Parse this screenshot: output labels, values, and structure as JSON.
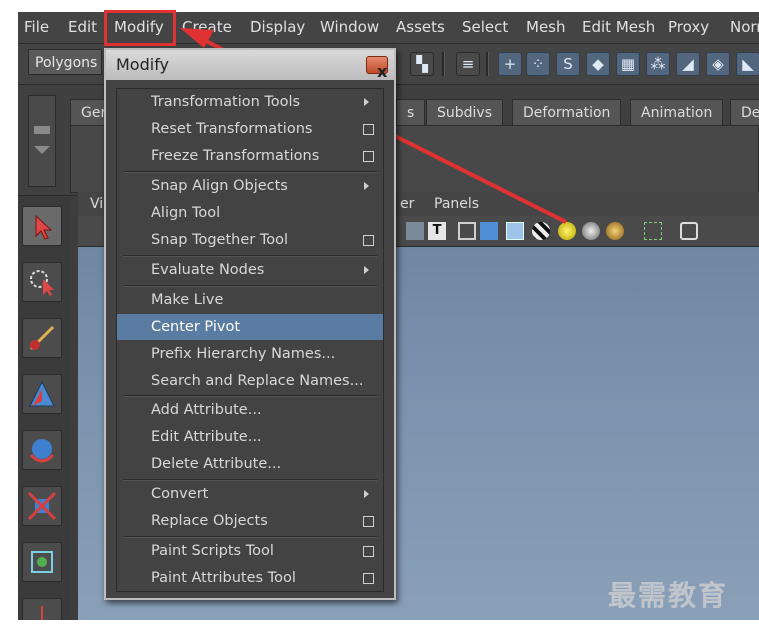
{
  "menubar": [
    "File",
    "Edit",
    "Modify",
    "Create",
    "Display",
    "Window",
    "Assets",
    "Select",
    "Mesh",
    "Edit Mesh",
    "Proxy",
    "Norm"
  ],
  "status_line": {
    "mode": "Polygons"
  },
  "shelf_tabs": [
    "Ger",
    "s",
    "Subdivs",
    "Deformation",
    "Animation",
    "De"
  ],
  "viewport_menu": [
    "Vi",
    "er",
    "Panels"
  ],
  "popup": {
    "title": "Modify",
    "close_symbol": "x",
    "items": [
      {
        "label": "Transformation Tools",
        "suffix": "arrow"
      },
      {
        "label": "Reset Transformations",
        "suffix": "box"
      },
      {
        "label": "Freeze Transformations",
        "suffix": "box"
      },
      {
        "label": "Snap Align Objects",
        "suffix": "arrow"
      },
      {
        "label": "Align Tool",
        "suffix": "none"
      },
      {
        "label": "Snap Together Tool",
        "suffix": "box"
      },
      {
        "label": "Evaluate Nodes",
        "suffix": "arrow"
      },
      {
        "label": "Make Live",
        "suffix": "none"
      },
      {
        "label": "Center Pivot",
        "suffix": "none",
        "highlighted": true
      },
      {
        "label": "Prefix Hierarchy Names...",
        "suffix": "none"
      },
      {
        "label": "Search and Replace Names...",
        "suffix": "none"
      },
      {
        "label": "Add Attribute...",
        "suffix": "none"
      },
      {
        "label": "Edit Attribute...",
        "suffix": "none"
      },
      {
        "label": "Delete Attribute...",
        "suffix": "none"
      },
      {
        "label": "Convert",
        "suffix": "arrow"
      },
      {
        "label": "Replace Objects",
        "suffix": "box"
      },
      {
        "label": "Paint Scripts Tool",
        "suffix": "box"
      },
      {
        "label": "Paint Attributes Tool",
        "suffix": "box"
      }
    ]
  },
  "watermark": "最需教育",
  "colors": {
    "highlight": "#5a7ca3",
    "annotation_red": "#e03232"
  }
}
